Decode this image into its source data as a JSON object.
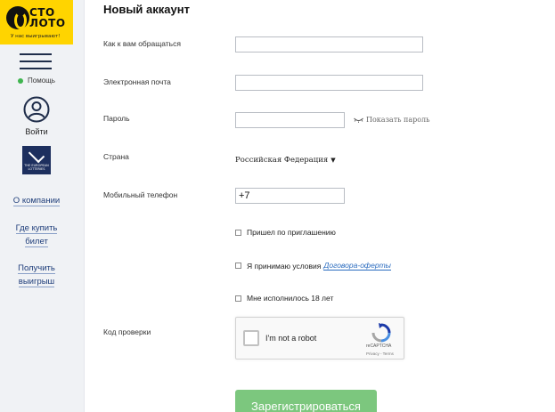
{
  "sidebar": {
    "logo": {
      "text_line1": "СТО",
      "text_line2": "ЛОТО",
      "slogan": "У нас выигрывают!"
    },
    "help_label": "Помощь",
    "login_label": "Войти",
    "eurolottery_text": "THE EUROPEAN LOTTERIES",
    "links": [
      {
        "line1": "О компании",
        "line2": ""
      },
      {
        "line1": "Где купить",
        "line2": "билет"
      },
      {
        "line1": "Получить",
        "line2": "выигрыш"
      }
    ]
  },
  "form": {
    "title": "Новый аккаунт",
    "labels": {
      "name": "Как к вам обращаться",
      "email": "Электронная почта",
      "password": "Пароль",
      "country": "Страна",
      "phone": "Мобильный телефон",
      "captcha": "Код проверки"
    },
    "values": {
      "name": "",
      "email": "",
      "password": "",
      "country": "Российская Федерация",
      "phone": "+7"
    },
    "show_password": "Показать пароль",
    "checkboxes": {
      "invited": "Пришел по приглашению",
      "terms_prefix": "Я принимаю условия",
      "terms_link": "Договора-оферты",
      "adult": "Мне исполнилось 18 лет"
    },
    "recaptcha": {
      "label": "I'm not a robot",
      "brand": "reCAPTCHA",
      "terms": "Privacy - Terms"
    },
    "register_label": "Зарегистрироваться"
  },
  "colors": {
    "logo_yellow": "#ffd400",
    "sidebar_bg": "#f0f2f5",
    "link_blue": "#1f3e7a",
    "register_green": "#7cc77e",
    "help_dot": "#3fb54f"
  }
}
